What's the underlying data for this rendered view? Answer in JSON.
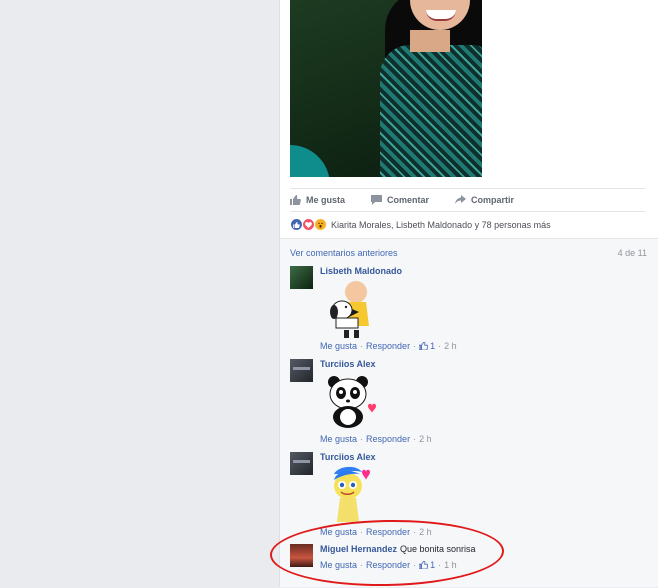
{
  "post": {
    "actions": [
      {
        "label": "Me gusta",
        "icon": "thumbs-up-icon"
      },
      {
        "label": "Comentar",
        "icon": "comment-icon"
      },
      {
        "label": "Compartir",
        "icon": "share-icon"
      }
    ],
    "reactions": {
      "icons": [
        "like-reaction-icon",
        "love-reaction-icon",
        "wow-reaction-icon"
      ],
      "summary": "Kiarita Morales, Lisbeth Maldonado y 78 personas más"
    },
    "comments": {
      "previous_link": "Ver comentarios anteriores",
      "counter": "4 de 11",
      "items": [
        {
          "author": "Lisbeth Maldonado",
          "text": "",
          "sticker": "snoopy-charlie-brown-hug-sticker",
          "like_label": "Me gusta",
          "reply_label": "Responder",
          "like_count": "1",
          "time": "2 h"
        },
        {
          "author": "Turciios Alex",
          "text": "",
          "sticker": "panda-heart-sticker",
          "like_label": "Me gusta",
          "reply_label": "Responder",
          "like_count": "",
          "time": "2 h"
        },
        {
          "author": "Turciios Alex",
          "text": "",
          "sticker": "joy-heart-sticker",
          "like_label": "Me gusta",
          "reply_label": "Responder",
          "like_count": "",
          "time": "2 h"
        },
        {
          "author": "Miguel Hernandez",
          "text": "Que bonita sonrisa",
          "sticker": "",
          "like_label": "Me gusta",
          "reply_label": "Responder",
          "like_count": "1",
          "time": "1 h"
        }
      ]
    }
  },
  "colors": {
    "link": "#4267b2",
    "author": "#365899",
    "muted": "#90949c",
    "annotation": "#e01a1a"
  },
  "separator": "·"
}
